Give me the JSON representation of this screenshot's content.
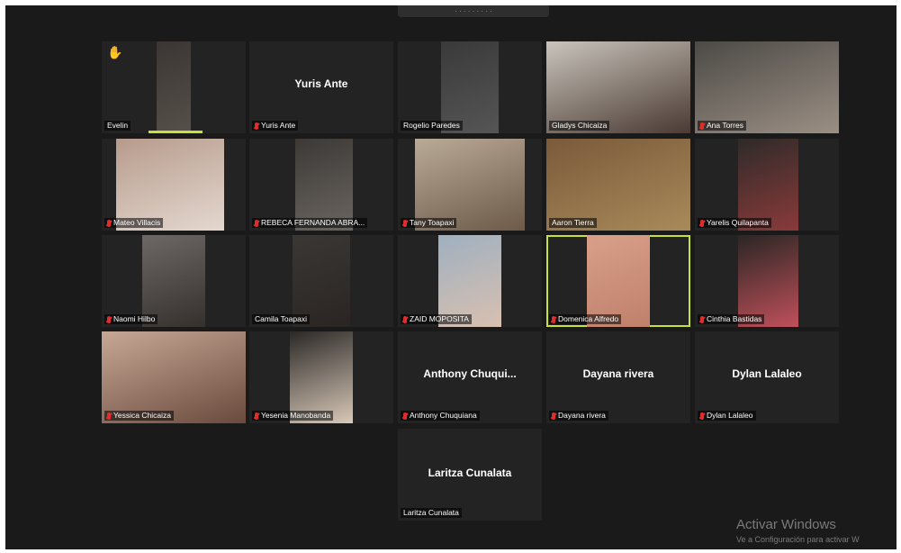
{
  "window": {
    "top_bar_text": "· · · · · · · · ·"
  },
  "participants": [
    {
      "label": "Evelin",
      "hand_raised": true,
      "mic_off": false,
      "video": true,
      "speaking_bar": true
    },
    {
      "label": "Yuris Ante",
      "big_name": "Yuris Ante",
      "mic_off": true,
      "video": false
    },
    {
      "label": "Rogelio Paredes",
      "mic_off": false,
      "video": true
    },
    {
      "label": "Gladys Chicaiza",
      "mic_off": false,
      "video": true
    },
    {
      "label": "Ana Torres",
      "mic_off": true,
      "video": true
    },
    {
      "label": "Mateo Villacis",
      "mic_off": true,
      "video": true
    },
    {
      "label": "REBECA FERNANDA ABRA...",
      "mic_off": true,
      "video": true
    },
    {
      "label": "Tany Toapaxi",
      "mic_off": true,
      "video": true
    },
    {
      "label": "Aaron Tierra",
      "mic_off": false,
      "video": true
    },
    {
      "label": "Yarelis Quilapanta",
      "mic_off": true,
      "video": true
    },
    {
      "label": "Naomi Hilbo",
      "mic_off": true,
      "video": true
    },
    {
      "label": "Camila Toapaxi",
      "mic_off": false,
      "video": true
    },
    {
      "label": "ZAID MOPOSITA",
      "mic_off": true,
      "video": true
    },
    {
      "label": "Domenica Alfredo",
      "mic_off": true,
      "video": true,
      "active": true
    },
    {
      "label": "Cinthia Bastidas",
      "mic_off": true,
      "video": true
    },
    {
      "label": "Yessica Chicaiza",
      "mic_off": true,
      "video": true
    },
    {
      "label": "Yesenia Manobanda",
      "mic_off": true,
      "video": true
    },
    {
      "label": "Anthony Chuquiana",
      "big_name": "Anthony  Chuqui...",
      "mic_off": true,
      "video": false
    },
    {
      "label": "Dayana rivera",
      "big_name": "Dayana rivera",
      "mic_off": true,
      "video": false
    },
    {
      "label": "Dylan Lalaleo",
      "big_name": "Dylan Lalaleo",
      "mic_off": true,
      "video": false
    },
    {
      "label": "Laritza Cunalata",
      "big_name": "Laritza Cunalata",
      "mic_off": false,
      "video": false
    }
  ],
  "colors": {
    "background": "#1a1a1a",
    "tile": "#232323",
    "active_border": "#c8e03a",
    "mic_muted": "#e02c2c"
  },
  "watermark": {
    "line1": "Activar Windows",
    "line2": "Ve a Configuración para activar W"
  }
}
